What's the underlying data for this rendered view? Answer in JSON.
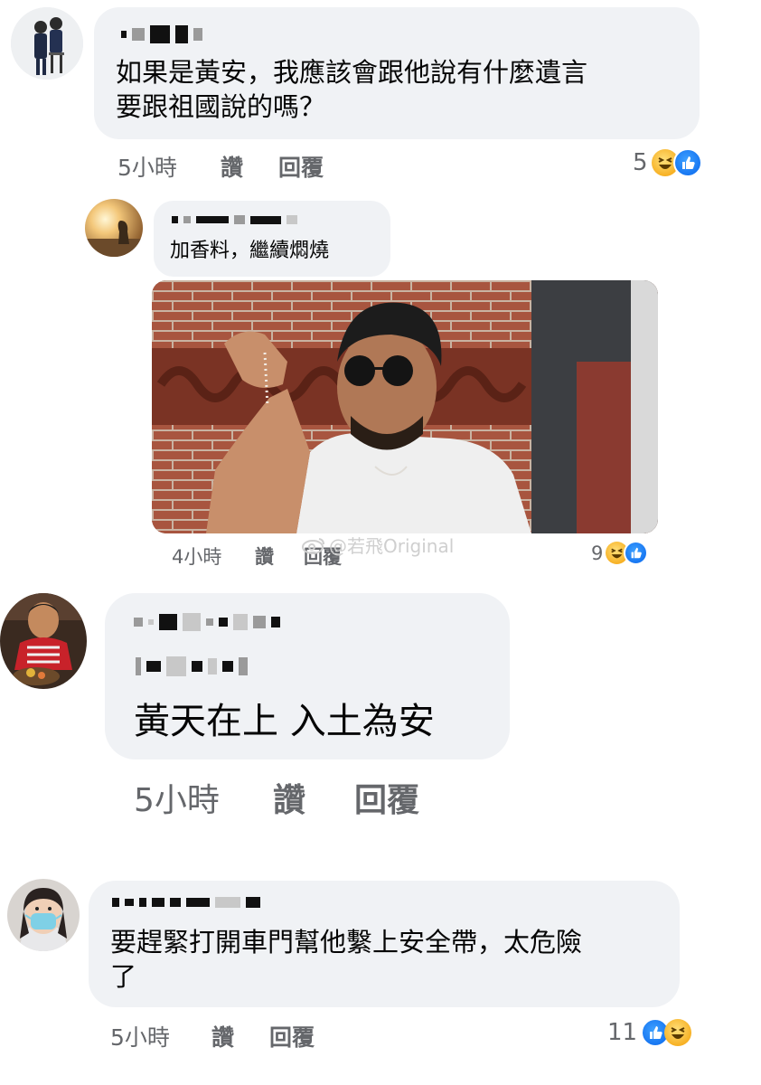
{
  "colors": {
    "bubble": "#f0f2f5",
    "meta_text": "#65676b",
    "like_blue": "#1877f2",
    "haha_yellow": "#f7b125"
  },
  "comments": [
    {
      "text": "如果是黃安，我應該會跟他說有什麼遺言\n要跟祖國說的嗎？",
      "time": "5小時",
      "like": "讚",
      "reply": "回覆",
      "reaction_count": "5",
      "reaction_icons": [
        "haha-icon",
        "like-icon"
      ]
    },
    {
      "text": "加香料，繼續燜燒",
      "time": "4小時",
      "like": "讚",
      "reply": "回覆",
      "reaction_count": "9",
      "reaction_icons": [
        "haha-icon",
        "like-icon"
      ],
      "image": "salt-sprinkling-chef-meme"
    },
    {
      "text": "黃天在上 入土為安",
      "time": "5小時",
      "like": "讚",
      "reply": "回覆"
    },
    {
      "text": "要趕緊打開車門幫他繫上安全帶，太危險\n了",
      "time": "5小時",
      "like": "讚",
      "reply": "回覆",
      "reaction_count": "11",
      "reaction_icons": [
        "like-icon",
        "haha-icon"
      ]
    }
  ],
  "watermark": "@若飛Original"
}
